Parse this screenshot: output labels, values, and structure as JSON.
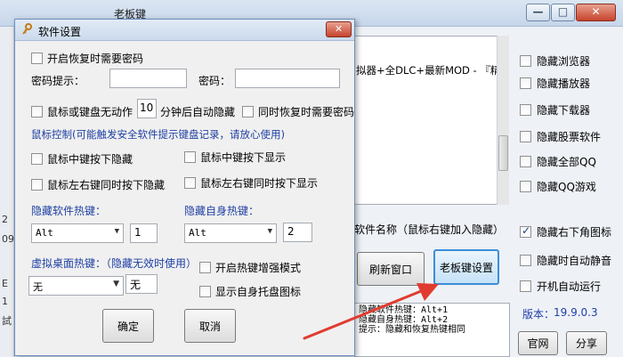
{
  "background_window": {
    "title": "老板键",
    "left_strip": [
      "2",
      "09",
      "E",
      "1",
      "試"
    ],
    "process_item": "拟器+全DLC+最新MOD - 『精品",
    "checkboxes": [
      {
        "label": "隐藏浏览器",
        "checked": false
      },
      {
        "label": "隐藏播放器",
        "checked": false
      },
      {
        "label": "隐藏下载器",
        "checked": false
      },
      {
        "label": "隐藏股票软件",
        "checked": false
      },
      {
        "label": "隐藏全部QQ",
        "checked": false
      },
      {
        "label": "隐藏QQ游戏",
        "checked": false
      },
      {
        "label": "隐藏右下角图标",
        "checked": true
      },
      {
        "label": "隐藏时自动静音",
        "checked": false
      },
      {
        "label": "开机自动运行",
        "checked": false
      }
    ],
    "process_hint": "软件名称（鼠标右键加入隐藏）",
    "refresh_button": "刷新窗口",
    "bosskey_button": "老板键设置",
    "hotkey_info": [
      "隐藏软件热键：Alt+1",
      "隐藏自身热键：Alt+2",
      "提示：隐藏和恢复热键相同"
    ],
    "version_label": "版本：",
    "version_value": "19.9.0.3",
    "website_button": "官网",
    "share_button": "分享",
    "window_buttons": {
      "minimize": "—",
      "maximize": "□",
      "close": "✕"
    }
  },
  "dialog": {
    "title": "软件设置",
    "close_glyph": "✕",
    "restore_password": {
      "label": "开启恢复时需要密码",
      "checked": false
    },
    "password_hint_label": "密码提示：",
    "password_hint_value": "",
    "password_label": "密码：",
    "password_value": "",
    "idle": {
      "prefix": "鼠标或键盘无动作",
      "minutes": "10",
      "suffix": "分钟后自动隐藏",
      "checked": false
    },
    "restore_needs_password": {
      "label": "同时恢复时需要密码",
      "checked": false
    },
    "mouse_control_note": "鼠标控制(可能触发安全软件提示键盘记录，请放心使用)",
    "mouse_options": [
      {
        "label": "鼠标中键按下隐藏",
        "checked": false
      },
      {
        "label": "鼠标中键按下显示",
        "checked": false
      },
      {
        "label": "鼠标左右键同时按下隐藏",
        "checked": false
      },
      {
        "label": "鼠标左右键同时按下显示",
        "checked": false
      }
    ],
    "hide_software_hotkey_label": "隐藏软件热键：",
    "hide_software_hotkey": {
      "modifier": "Alt",
      "key": "1"
    },
    "hide_self_hotkey_label": "隐藏自身热键：",
    "hide_self_hotkey": {
      "modifier": "Alt",
      "key": "2"
    },
    "virtual_desktop_label": "虚拟桌面热键：（隐藏无效时使用）",
    "virtual_desktop_hotkey": {
      "modifier": "无",
      "key": "无"
    },
    "enhanced_hotkey": {
      "label": "开启热键增强模式",
      "checked": false
    },
    "show_tray_icon": {
      "label": "显示自身托盘图标",
      "checked": false
    },
    "ok_button": "确定",
    "cancel_button": "取消",
    "dropdown_arrow": "▼"
  },
  "colors": {
    "accent_blue": "#1e3fa3",
    "arrow_red": "#e03b2f",
    "highlight_border": "#3b8ed9"
  }
}
